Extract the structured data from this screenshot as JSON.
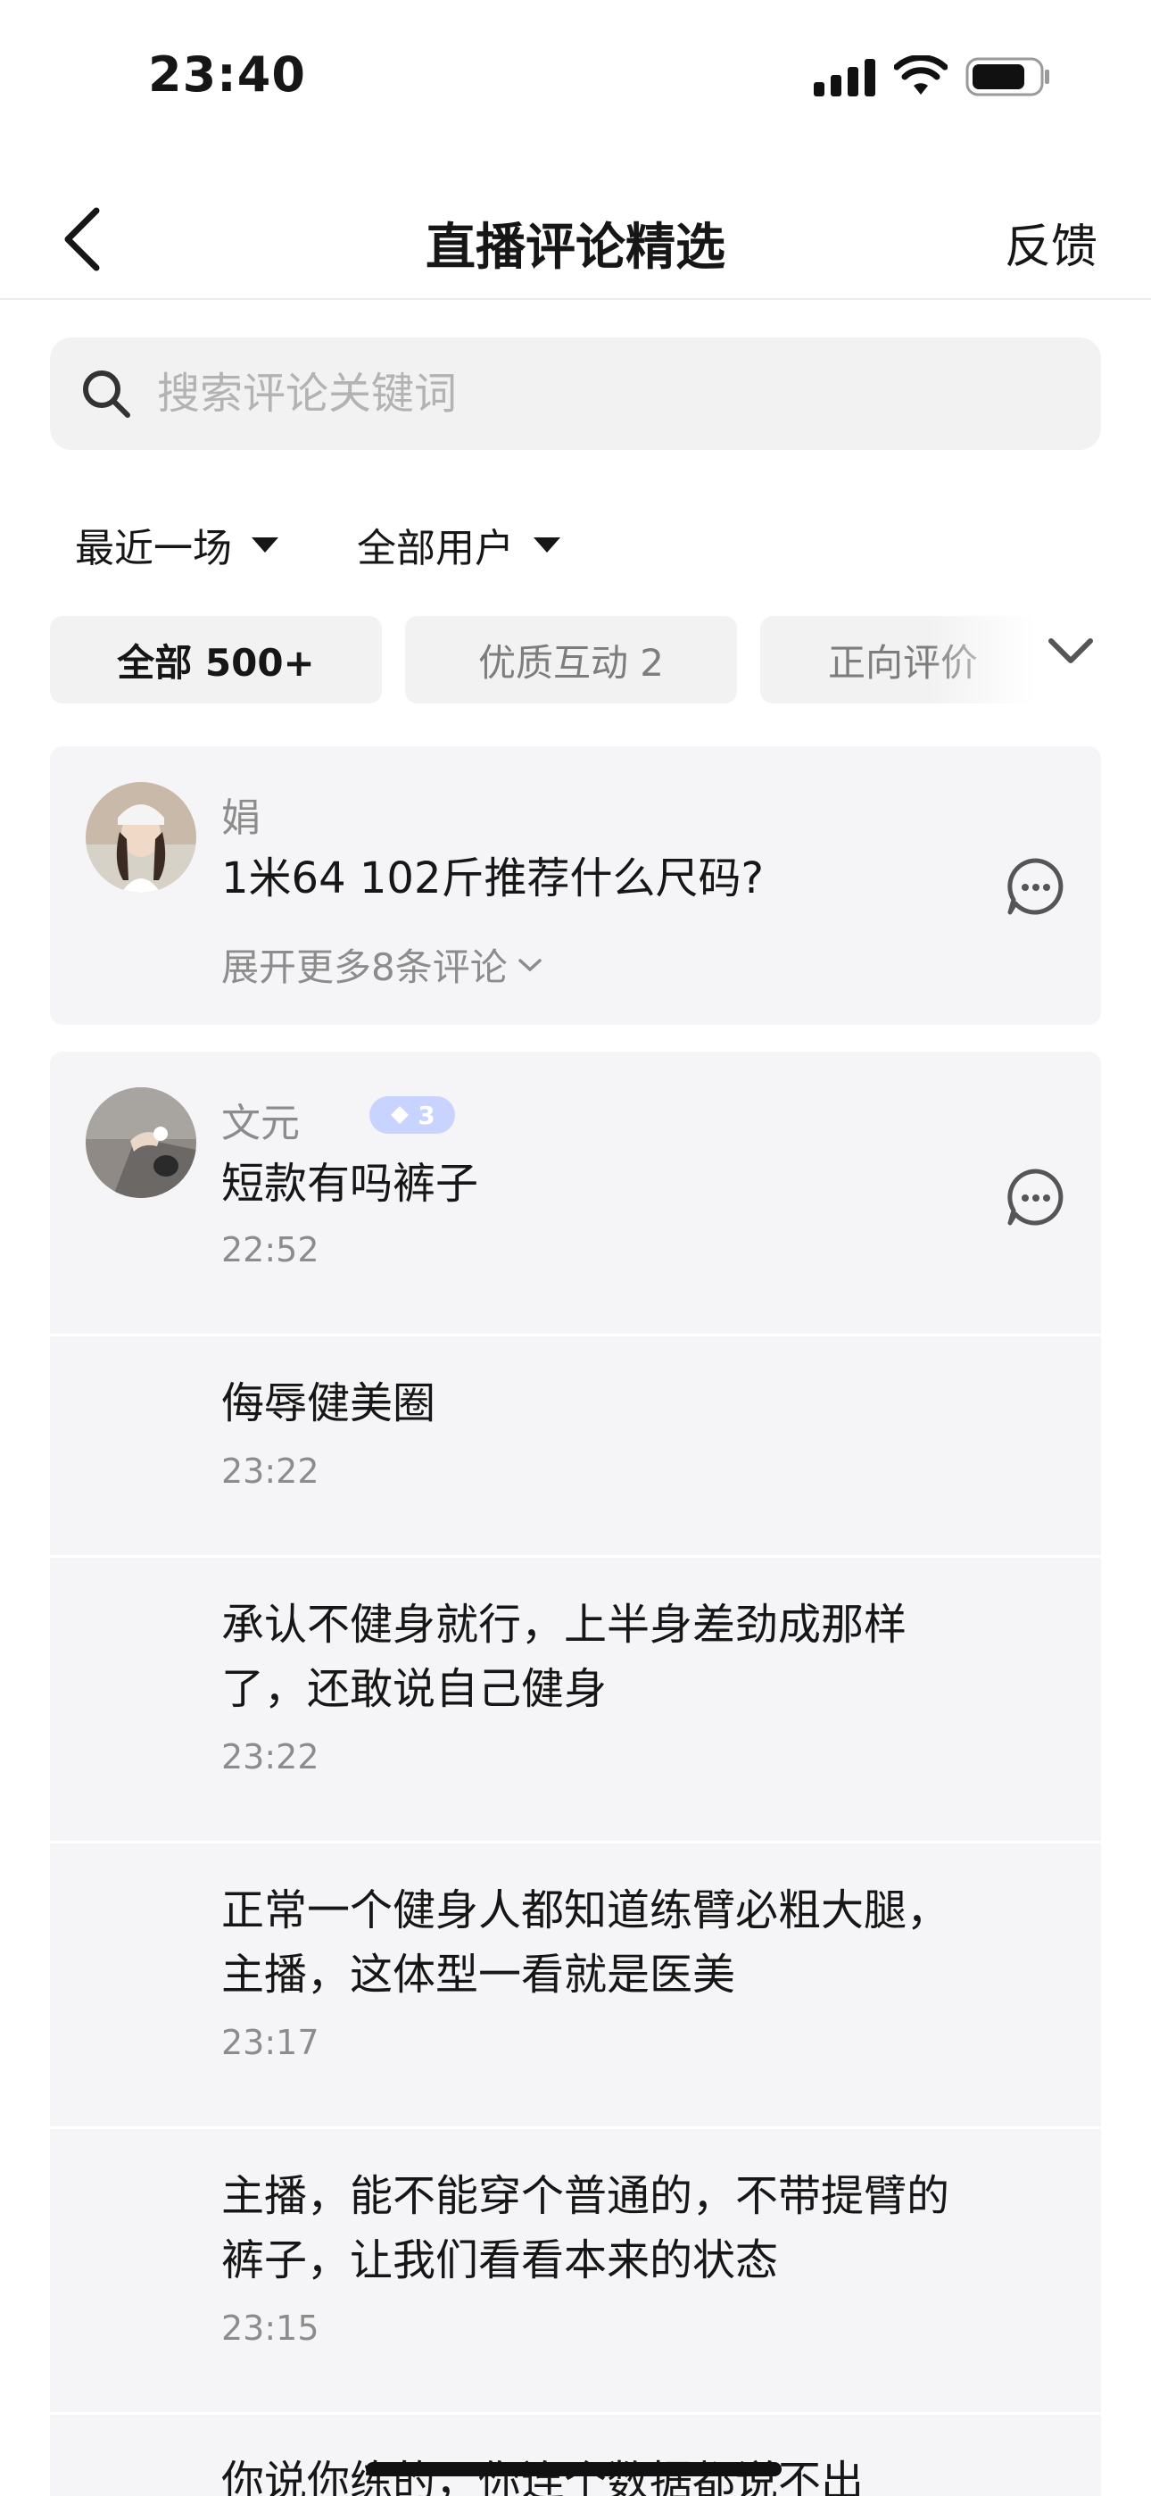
{
  "status_bar": {
    "time": "23:40"
  },
  "nav": {
    "title": "直播评论精选",
    "feedback_label": "反馈"
  },
  "search": {
    "placeholder": "搜索评论关键词"
  },
  "filters": {
    "recent": "最近一场",
    "users": "全部用户"
  },
  "tabs": [
    {
      "label": "全部 500+",
      "selected": true
    },
    {
      "label": "优质互动 2",
      "selected": false
    },
    {
      "label": "正向评价",
      "selected": false
    }
  ],
  "comments": {
    "first": {
      "username": "娟",
      "text": "1米64 102斤推荐什么尺码?",
      "expand_label": "展开更多8条评论"
    },
    "second": {
      "username": "文元",
      "level": "3",
      "replies": [
        {
          "text": "短款有吗裤子",
          "time": "22:52"
        },
        {
          "text": "侮辱健美圈",
          "time": "23:22"
        },
        {
          "text": "承认不健身就行，上半身差劲成那样了，还敢说自己健身",
          "time": "23:22"
        },
        {
          "text": "正常一个健身人都知道练臂必粗大腿，主播，这体型一看就是医美",
          "time": "23:17"
        },
        {
          "text": "主播，能不能穿个普通的，不带提臂的裤子，让我们看看本来的状态",
          "time": "23:15"
        },
        {
          "text": "你说你练的，你连个数据都说不出",
          "time": ""
        }
      ]
    }
  },
  "colors": {
    "accent_badge": "#c9d3ff",
    "card_bg": "#f5f5f7",
    "muted_text": "#8c8c8c"
  }
}
